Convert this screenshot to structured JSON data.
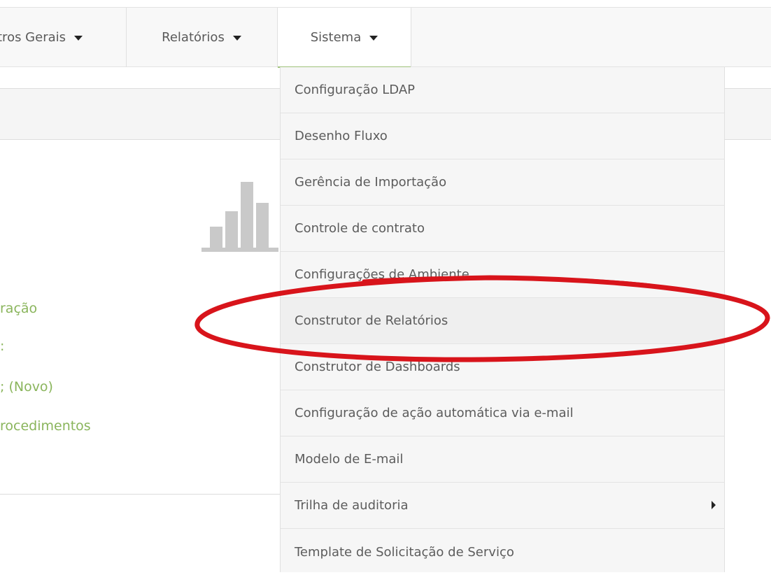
{
  "nav": {
    "cadastros_label": "tros Gerais",
    "relatorios_label": "Relatórios",
    "sistema_label": "Sistema"
  },
  "sidebar_links": [
    "ração",
    ":",
    "; (Novo)",
    "rocedimentos"
  ],
  "dropdown": {
    "items": [
      "Configuração LDAP",
      "Desenho Fluxo",
      "Gerência de Importação",
      "Controle de contrato",
      "Configurações de Ambiente",
      "Construtor de Relatórios",
      "Construtor de Dashboards",
      "Configuração de ação automática via e-mail",
      "Modelo de E-mail",
      "Trilha de auditoria",
      "Template de Solicitação de Serviço"
    ],
    "highlighted_index": 5,
    "submenu_index": 9
  },
  "icons": {
    "caret": "caret-down-icon",
    "submenu": "caret-right-icon",
    "chart": "bar-chart-icon"
  },
  "colors": {
    "link_green": "#8ab55c",
    "annotation_red": "#d8141b",
    "active_tab_border": "#9ec27a"
  }
}
